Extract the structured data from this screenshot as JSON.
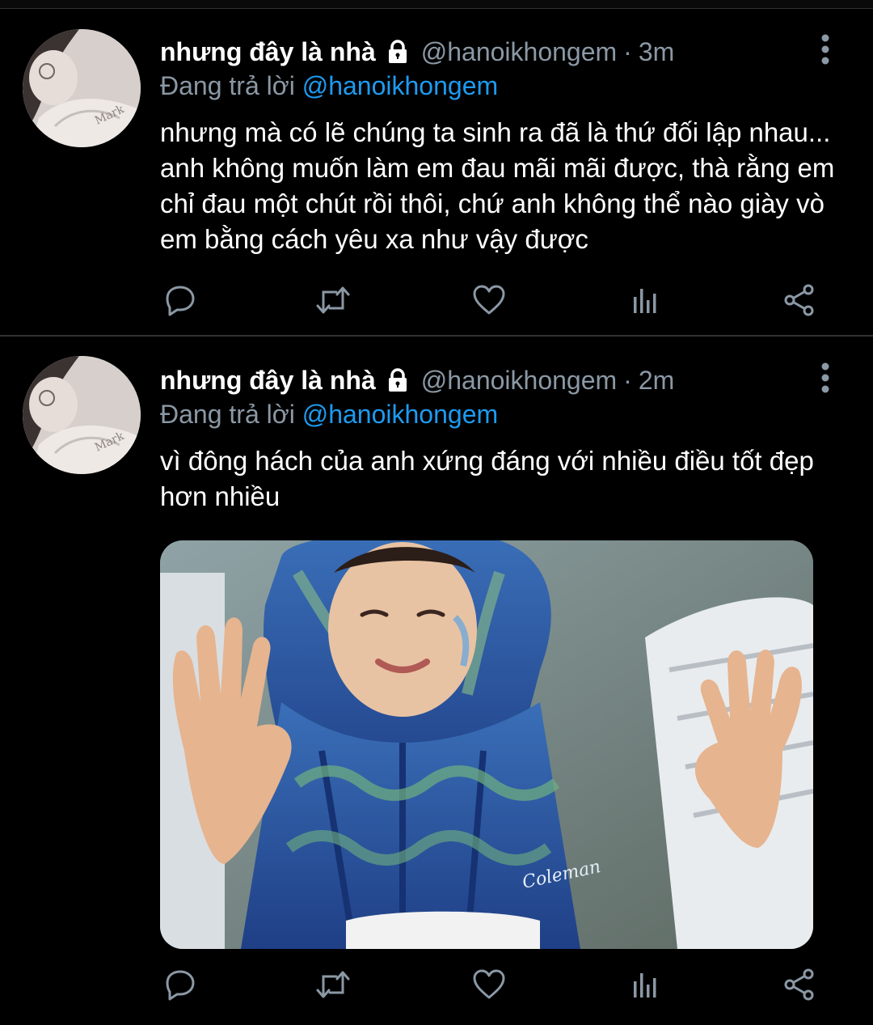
{
  "colors": {
    "background": "#000000",
    "text": "#ffffff",
    "muted": "#8b98a5",
    "accent": "#1d9bf0",
    "divider": "#2f3336"
  },
  "tweets": [
    {
      "display_name": "nhưng đây là nhà",
      "handle": "@hanoikhongem",
      "separator": "·",
      "time": "3m",
      "replying_prefix": "Đang trả lời",
      "replying_to": "@hanoikhongem",
      "text": "nhưng mà có lẽ chúng ta sinh ra đã là thứ đối lập nhau... anh không muốn làm em đau mãi mãi được, thà rằng em chỉ đau một chút rồi thôi, chứ anh không thể nào giày vò em bằng cách yêu xa như vậy được",
      "icons": {
        "lock": "lock-icon",
        "more": "more-vertical-icon",
        "reply": "reply-icon",
        "retweet": "retweet-icon",
        "like": "like-icon",
        "analytics": "analytics-icon",
        "share": "share-icon"
      }
    },
    {
      "display_name": "nhưng đây là nhà",
      "handle": "@hanoikhongem",
      "separator": "·",
      "time": "2m",
      "replying_prefix": "Đang trả lời",
      "replying_to": "@hanoikhongem",
      "text": "vì đông hách của anh xứng đáng với nhiều điều tốt đẹp hơn nhiều",
      "media": {
        "printed_text": "Coleman"
      },
      "icons": {
        "lock": "lock-icon",
        "more": "more-vertical-icon",
        "reply": "reply-icon",
        "retweet": "retweet-icon",
        "like": "like-icon",
        "analytics": "analytics-icon",
        "share": "share-icon"
      }
    }
  ]
}
